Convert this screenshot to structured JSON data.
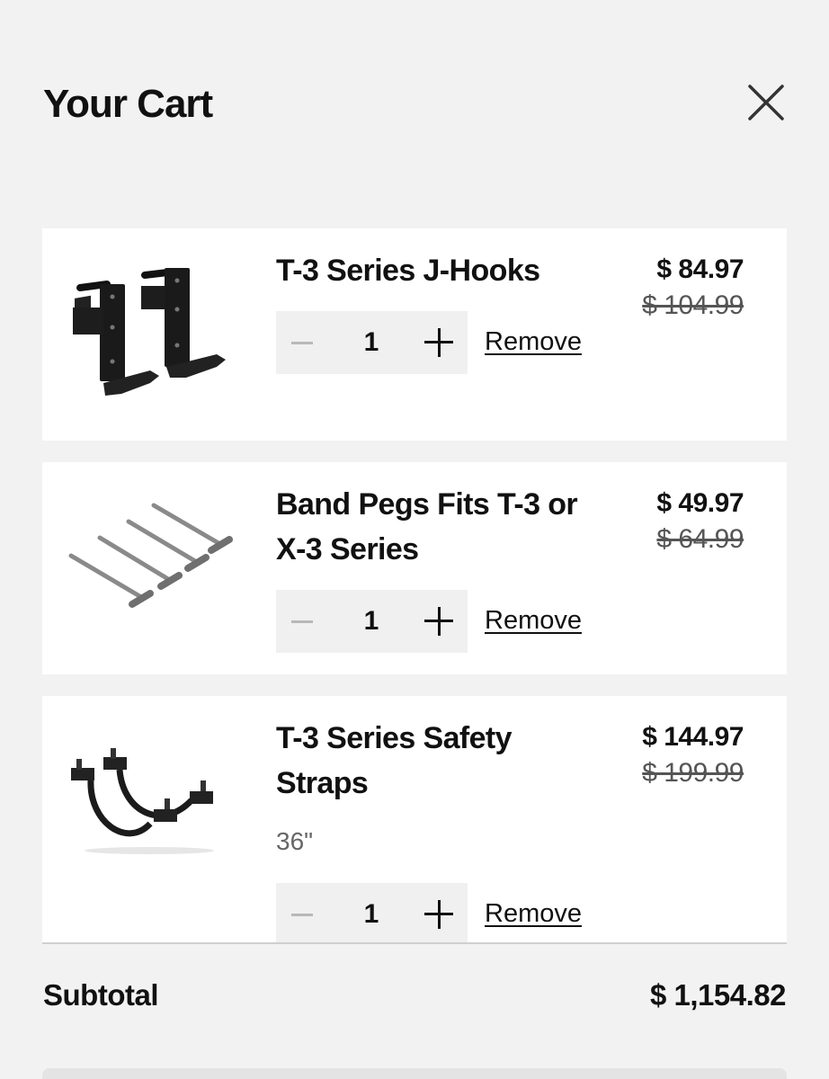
{
  "cart": {
    "title": "Your Cart",
    "close_icon": "close-icon",
    "items": [
      {
        "name": "T-3 Series J-Hooks",
        "sale_price": "$ 84.97",
        "original_price": "$ 104.99",
        "quantity": "1",
        "remove_label": "Remove",
        "image_icon": "j-hooks-image"
      },
      {
        "name": "Band Pegs Fits T-3 or X-3 Series",
        "sale_price": "$ 49.97",
        "original_price": "$ 64.99",
        "quantity": "1",
        "remove_label": "Remove",
        "image_icon": "band-pegs-image"
      },
      {
        "name": "T-3 Series Safety Straps",
        "variant": "36\"",
        "sale_price": "$ 144.97",
        "original_price": "$ 199.99",
        "quantity": "1",
        "remove_label": "Remove",
        "image_icon": "safety-straps-image"
      }
    ],
    "subtotal_label": "Subtotal",
    "subtotal_value": "$ 1,154.82"
  },
  "colors": {
    "background": "#f2f2f2",
    "card": "#ffffff",
    "stepper": "#f0f0f0",
    "text": "#111111",
    "muted": "#555555"
  }
}
